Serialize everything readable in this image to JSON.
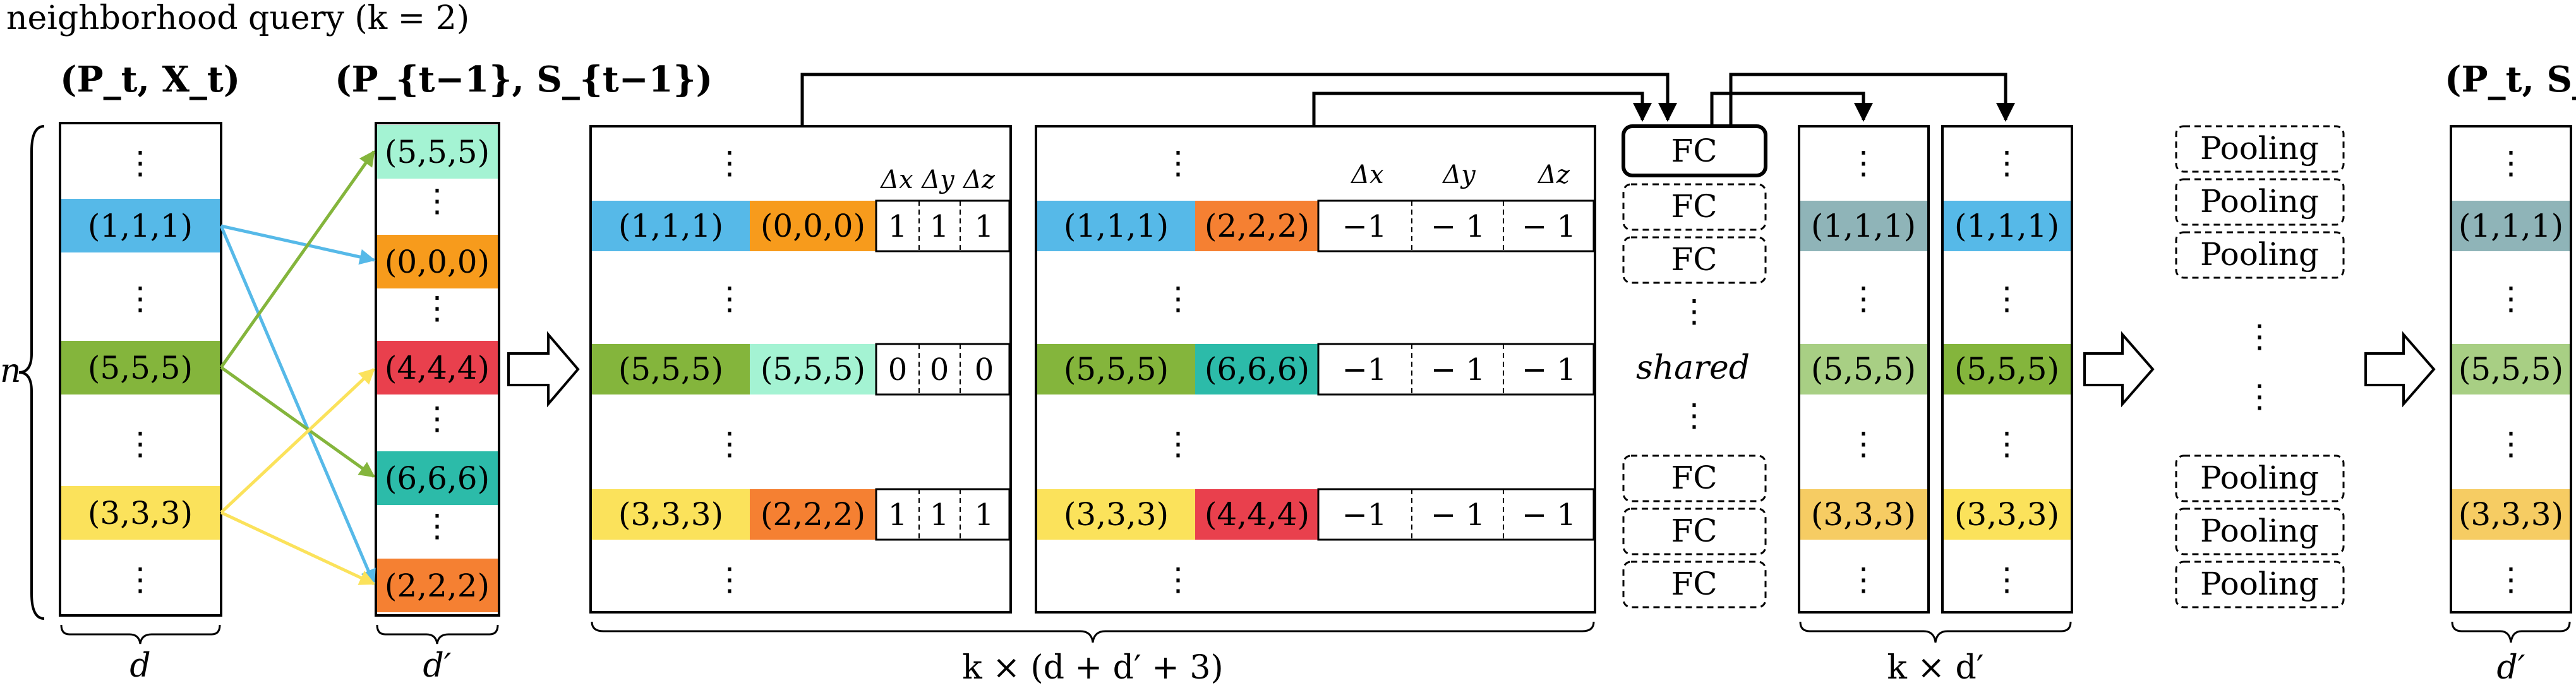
{
  "title": "neighborhood query (k = 2)",
  "input_header": "(P_t, X_t)",
  "prev_header": "(P_{t−1}, S_{t−1})",
  "output_header": "(P_t, S_t)",
  "n_label": "n",
  "vdots": "⋮",
  "colors": {
    "blue": "#56b9e8",
    "green": "#84b53c",
    "yellow": "#fbe25b",
    "mint": "#a4f3d3",
    "orange": "#f79b1c",
    "red": "#e9404d",
    "teal": "#2cbba9",
    "orange2": "#f58032",
    "out_blue": "#8fb4b8",
    "out_green": "#a8cf84",
    "out_yellow": "#f6cc63"
  },
  "input_column": {
    "rows": [
      {
        "label": "(1,1,1)",
        "color": "blue"
      },
      {
        "label": "(5,5,5)",
        "color": "green"
      },
      {
        "label": "(3,3,3)",
        "color": "yellow"
      }
    ],
    "brace_label": "d"
  },
  "prev_column": {
    "rows": [
      {
        "label": "(5,5,5)",
        "color": "mint"
      },
      {
        "label": "(0,0,0)",
        "color": "orange"
      },
      {
        "label": "(4,4,4)",
        "color": "red"
      },
      {
        "label": "(6,6,6)",
        "color": "teal"
      },
      {
        "label": "(2,2,2)",
        "color": "orange2"
      }
    ],
    "brace_label": "d′"
  },
  "neighbor_table_1": {
    "delta_headers": [
      "Δx",
      "Δy",
      "Δz"
    ],
    "rows": [
      {
        "point": "(1,1,1)",
        "point_color": "blue",
        "neighbor": "(0,0,0)",
        "neighbor_color": "orange",
        "deltas": [
          "1",
          "1",
          "1"
        ]
      },
      {
        "point": "(5,5,5)",
        "point_color": "green",
        "neighbor": "(5,5,5)",
        "neighbor_color": "mint",
        "deltas": [
          "0",
          "0",
          "0"
        ]
      },
      {
        "point": "(3,3,3)",
        "point_color": "yellow",
        "neighbor": "(2,2,2)",
        "neighbor_color": "orange2",
        "deltas": [
          "1",
          "1",
          "1"
        ]
      }
    ]
  },
  "neighbor_table_2": {
    "delta_headers": [
      "Δx",
      "Δy",
      "Δz"
    ],
    "rows": [
      {
        "point": "(1,1,1)",
        "point_color": "blue",
        "neighbor": "(2,2,2)",
        "neighbor_color": "orange2",
        "deltas": [
          "−1",
          "− 1",
          "− 1"
        ]
      },
      {
        "point": "(5,5,5)",
        "point_color": "green",
        "neighbor": "(6,6,6)",
        "neighbor_color": "teal",
        "deltas": [
          "−1",
          "− 1",
          "− 1"
        ]
      },
      {
        "point": "(3,3,3)",
        "point_color": "yellow",
        "neighbor": "(4,4,4)",
        "neighbor_color": "red",
        "deltas": [
          "−1",
          "− 1",
          "− 1"
        ]
      }
    ]
  },
  "tables_brace_label": "k × (d + d′ + 3)",
  "fc": {
    "label": "FC",
    "shared_label": "shared"
  },
  "fc_out_1": {
    "rows": [
      {
        "label": "(1,1,1)",
        "color": "out_blue"
      },
      {
        "label": "(5,5,5)",
        "color": "out_green"
      },
      {
        "label": "(3,3,3)",
        "color": "out_yellow"
      }
    ]
  },
  "fc_out_2": {
    "rows": [
      {
        "label": "(1,1,1)",
        "color": "blue"
      },
      {
        "label": "(5,5,5)",
        "color": "green"
      },
      {
        "label": "(3,3,3)",
        "color": "yellow"
      }
    ]
  },
  "fc_brace_label": "k × d′",
  "pooling_label": "Pooling",
  "output_column": {
    "rows": [
      {
        "label": "(1,1,1)",
        "color": "out_blue"
      },
      {
        "label": "(5,5,5)",
        "color": "out_green"
      },
      {
        "label": "(3,3,3)",
        "color": "out_yellow"
      }
    ],
    "brace_label": "d′"
  }
}
